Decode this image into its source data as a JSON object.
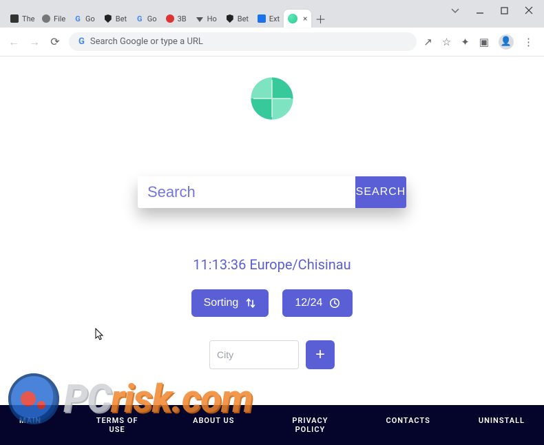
{
  "window": {
    "tabs": [
      {
        "label": "The",
        "favicon": "printer"
      },
      {
        "label": "File",
        "favicon": "globe"
      },
      {
        "label": "Go",
        "favicon": "google"
      },
      {
        "label": "Bet",
        "favicon": "shield"
      },
      {
        "label": "Go",
        "favicon": "google"
      },
      {
        "label": "3B",
        "favicon": "red"
      },
      {
        "label": "Ho",
        "favicon": "download"
      },
      {
        "label": "Bet",
        "favicon": "shield"
      },
      {
        "label": "Ext",
        "favicon": "puzzle"
      },
      {
        "label": "",
        "favicon": "app",
        "active": true
      }
    ]
  },
  "toolbar": {
    "address_placeholder": "Search Google or type a URL"
  },
  "page": {
    "search_placeholder": "Search",
    "search_button": "SEARCH",
    "clock_time": "11:13:36",
    "clock_tz": "Europe/Chisinau",
    "sort_button": "Sorting",
    "format_button": "12/24",
    "city_placeholder": "City"
  },
  "footer": {
    "links": [
      "MAIN",
      "TERMS OF USE",
      "ABOUT US",
      "PRIVACY POLICY",
      "CONTACTS",
      "UNINSTALL"
    ]
  },
  "watermark": {
    "part1": "PC",
    "part2": "risk.com"
  }
}
